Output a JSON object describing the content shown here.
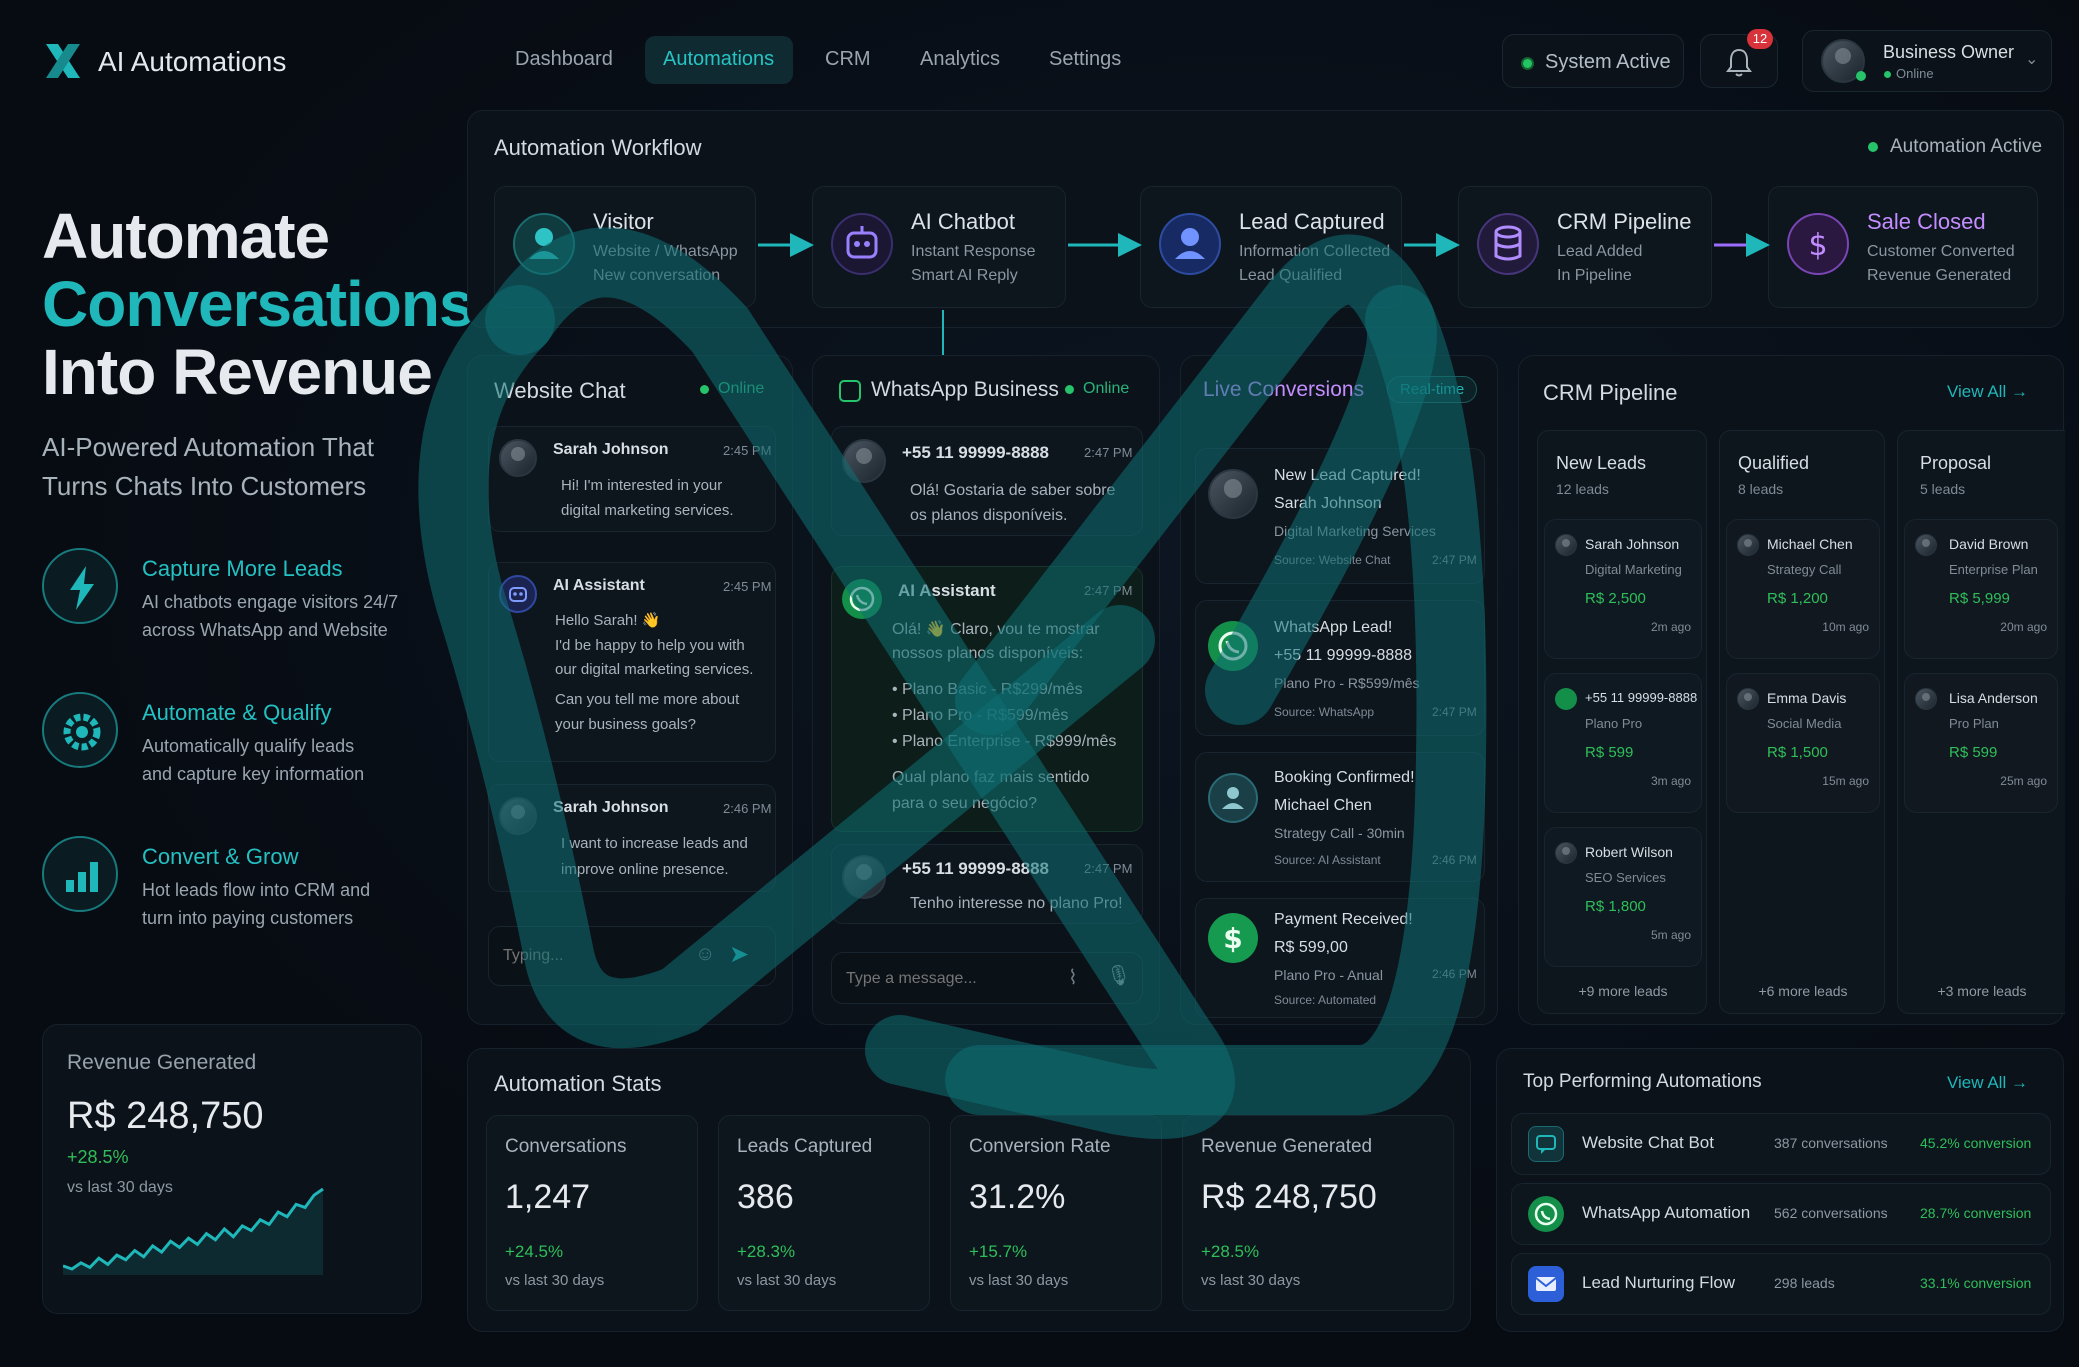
{
  "brand": {
    "name": "AI Automations",
    "accent": "#1fb7b9"
  },
  "nav": {
    "items": [
      "Dashboard",
      "Automations",
      "CRM",
      "Analytics",
      "Settings"
    ],
    "active": "Automations"
  },
  "header": {
    "system_status": "System Active",
    "notifications": "12",
    "user_name": "Business Owner",
    "user_status": "Online"
  },
  "hero": {
    "line1": "Automate",
    "line2": "Conversations",
    "line3": "Into Revenue",
    "subtitle_1": "AI-Powered Automation That",
    "subtitle_2": "Turns Chats Into Customers"
  },
  "features": [
    {
      "title": "Capture More Leads",
      "line1": "AI chatbots engage visitors 24/7",
      "line2": "across WhatsApp and Website",
      "icon": "lightning-icon"
    },
    {
      "title": "Automate & Qualify",
      "line1": "Automatically qualify leads",
      "line2": "and capture key information",
      "icon": "gear-icon"
    },
    {
      "title": "Convert & Grow",
      "line1": "Hot leads flow into CRM and",
      "line2": "turn into paying customers",
      "icon": "bar-chart-icon"
    }
  ],
  "revenue_card": {
    "label": "Revenue Generated",
    "value": "R$ 248,750",
    "change": "+28.5%",
    "period": "vs last 30 days",
    "sparkline": [
      12,
      10,
      14,
      11,
      17,
      13,
      19,
      16,
      22,
      18,
      25,
      21,
      28,
      24,
      30,
      26,
      33,
      29,
      36,
      31,
      38,
      35,
      42,
      39,
      47,
      44,
      52,
      50,
      58,
      62
    ]
  },
  "workflow": {
    "title": "Automation Workflow",
    "status": "Automation Active",
    "steps": [
      {
        "title": "Visitor",
        "line1": "Website / WhatsApp",
        "line2": "New conversation",
        "color": "#1fb7b9"
      },
      {
        "title": "AI Chatbot",
        "line1": "Instant Response",
        "line2": "Smart AI Reply",
        "color": "#8a6cff"
      },
      {
        "title": "Lead Captured",
        "line1": "Information Collected",
        "line2": "Lead Qualified",
        "color": "#3f6cff"
      },
      {
        "title": "CRM Pipeline",
        "line1": "Lead Added",
        "line2": "In Pipeline",
        "color": "#9b6cff"
      },
      {
        "title": "Sale Closed",
        "line1": "Customer Converted",
        "line2": "Revenue Generated",
        "color": "#b46cff"
      }
    ]
  },
  "website_chat": {
    "title": "Website Chat",
    "status": "Online",
    "input_placeholder": "Typing...",
    "messages": [
      {
        "name": "Sarah Johnson",
        "time": "2:45 PM",
        "lines": [
          "Hi! I'm interested in your",
          "digital marketing services."
        ]
      },
      {
        "name": "AI Assistant",
        "time": "2:45 PM",
        "lines": [
          "Hello Sarah! 👋",
          "I'd be happy to help you with",
          "our digital marketing services.",
          "Can you tell me more about",
          "your business goals?"
        ]
      },
      {
        "name": "Sarah Johnson",
        "time": "2:46 PM",
        "lines": [
          "I want to increase leads and",
          "improve online presence."
        ]
      }
    ]
  },
  "whatsapp": {
    "title": "WhatsApp Business",
    "status": "Online",
    "input_placeholder": "Type a message...",
    "messages": [
      {
        "name": "+55 11 99999-8888",
        "time": "2:47 PM",
        "lines": [
          "Olá! Gostaria de saber sobre",
          "os planos disponíveis."
        ]
      },
      {
        "name": "AI Assistant",
        "time": "2:47 PM",
        "lines": [
          "Olá! 👋 Claro, vou te mostrar",
          "nossos planos disponíveis:",
          "• Plano Basic - R$299/mês",
          "• Plano Pro - R$599/mês",
          "• Plano Enterprise - R$999/mês",
          "Qual plano faz mais sentido",
          "para o seu negócio?"
        ]
      },
      {
        "name": "+55 11 99999-8888",
        "time": "2:47 PM",
        "lines": [
          "Tenho interesse no plano Pro!"
        ]
      }
    ]
  },
  "live": {
    "title": "Live Conversions",
    "badge": "Real-time",
    "items": [
      {
        "title": "New Lead Captured!",
        "name": "Sarah Johnson",
        "detail": "Digital Marketing Services",
        "source": "Source: Website Chat",
        "time": "2:47 PM",
        "icon": "user-avatar-icon"
      },
      {
        "title": "WhatsApp Lead!",
        "name": "+55 11 99999-8888",
        "detail": "Plano Pro - R$599/mês",
        "source": "Source: WhatsApp",
        "time": "2:47 PM",
        "icon": "whatsapp-icon"
      },
      {
        "title": "Booking Confirmed!",
        "name": "Michael Chen",
        "detail": "Strategy Call - 30min",
        "source": "Source: AI Assistant",
        "time": "2:46 PM",
        "icon": "calendar-user-icon"
      },
      {
        "title": "Payment Received!",
        "name": "R$ 599,00",
        "detail": "Plano Pro - Anual",
        "source": "Source: Automated",
        "time": "2:46 PM",
        "icon": "dollar-icon"
      }
    ]
  },
  "crm": {
    "title": "CRM Pipeline",
    "view_all": "View All",
    "columns": [
      {
        "title": "New Leads",
        "count": "12 leads",
        "more": "+9 more leads",
        "cards": [
          {
            "name": "Sarah Johnson",
            "sub": "Digital Marketing",
            "value": "R$ 2,500",
            "ago": "2m ago"
          },
          {
            "name": "+55 11 99999-8888",
            "sub": "Plano Pro",
            "value": "R$ 599",
            "ago": "3m ago"
          },
          {
            "name": "Robert Wilson",
            "sub": "SEO Services",
            "value": "R$ 1,800",
            "ago": "5m ago"
          }
        ]
      },
      {
        "title": "Qualified",
        "count": "8 leads",
        "more": "+6 more leads",
        "cards": [
          {
            "name": "Michael Chen",
            "sub": "Strategy Call",
            "value": "R$ 1,200",
            "ago": "10m ago"
          },
          {
            "name": "Emma Davis",
            "sub": "Social Media",
            "value": "R$ 1,500",
            "ago": "15m ago"
          }
        ]
      },
      {
        "title": "Proposal",
        "count": "5 leads",
        "more": "+3 more leads",
        "cards": [
          {
            "name": "David Brown",
            "sub": "Enterprise Plan",
            "value": "R$ 5,999",
            "ago": "20m ago"
          },
          {
            "name": "Lisa Anderson",
            "sub": "Pro Plan",
            "value": "R$ 599",
            "ago": "25m ago"
          }
        ]
      }
    ]
  },
  "stats": {
    "title": "Automation Stats",
    "items": [
      {
        "label": "Conversations",
        "value": "1,247",
        "change": "+24.5%",
        "period": "vs last 30 days"
      },
      {
        "label": "Leads Captured",
        "value": "386",
        "change": "+28.3%",
        "period": "vs last 30 days"
      },
      {
        "label": "Conversion Rate",
        "value": "31.2%",
        "change": "+15.7%",
        "period": "vs last 30 days"
      },
      {
        "label": "Revenue Generated",
        "value": "R$ 248,750",
        "change": "+28.5%",
        "period": "vs last 30 days"
      }
    ]
  },
  "top": {
    "title": "Top Performing Automations",
    "view_all": "View All",
    "items": [
      {
        "name": "Website Chat Bot",
        "count": "387 conversations",
        "rate": "45.2% conversion",
        "icon": "chat-icon",
        "color": "#1fb7b9"
      },
      {
        "name": "WhatsApp Automation",
        "count": "562 conversations",
        "rate": "28.7% conversion",
        "icon": "whatsapp-icon",
        "color": "#25c36b"
      },
      {
        "name": "Lead Nurturing Flow",
        "count": "298 leads",
        "rate": "33.1% conversion",
        "icon": "mail-icon",
        "color": "#3a7bff"
      }
    ]
  }
}
